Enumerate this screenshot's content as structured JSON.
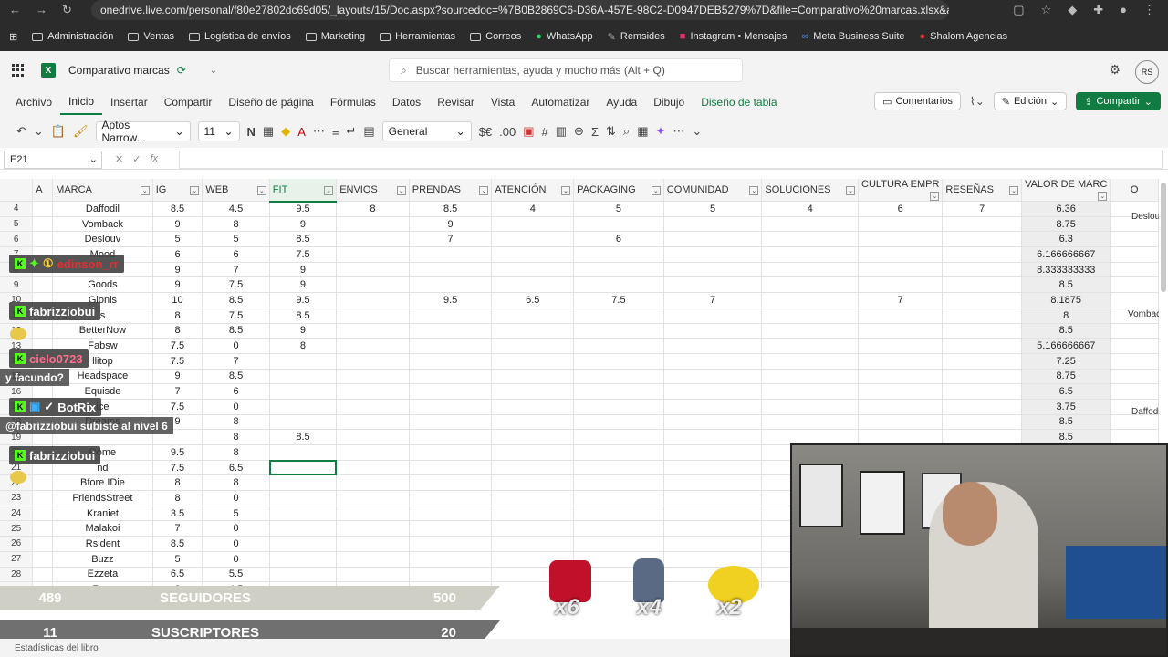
{
  "browser": {
    "url": "onedrive.live.com/personal/f80e27802dc69d05/_layouts/15/Doc.aspx?sourcedoc=%7B0B2869C6-D36A-457E-98C2-D0947DEB5279%7D&file=Comparativo%20marcas.xlsx&act...",
    "bookmarks": [
      "Administración",
      "Ventas",
      "Logística de envíos",
      "Marketing",
      "Herramientas",
      "Correos",
      "WhatsApp",
      "Remsides",
      "Instagram • Mensajes",
      "Meta Business Suite",
      "Shalom Agencias"
    ]
  },
  "app": {
    "doc_title": "Comparativo marcas",
    "search_placeholder": "Buscar herramientas, ayuda y mucho más (Alt + Q)",
    "avatar_initials": "RS",
    "menu": [
      "Archivo",
      "Inicio",
      "Insertar",
      "Compartir",
      "Diseño de página",
      "Fórmulas",
      "Datos",
      "Revisar",
      "Vista",
      "Automatizar",
      "Ayuda",
      "Dibujo",
      "Diseño de tabla"
    ],
    "comments_label": "Comentarios",
    "edit_label": "Edición",
    "share_label": "Compartir",
    "font_name": "Aptos Narrow...",
    "font_size": "11",
    "number_format": "General",
    "name_box": "E21",
    "fx_label": "fx"
  },
  "sheet": {
    "col_letters": [
      "A",
      "O"
    ],
    "headers": [
      "MARCA",
      "IG",
      "WEB",
      "FIT",
      "ENVIOS",
      "PRENDAS",
      "ATENCIÓN",
      "PACKAGING",
      "COMUNIDAD",
      "SOLUCIONES",
      "CULTURA EMPR",
      "RESEÑAS",
      "VALOR DE MARC"
    ],
    "rows": [
      {
        "n": "4",
        "c": [
          "Daffodil",
          "8.5",
          "4.5",
          "9.5",
          "8",
          "8.5",
          "4",
          "5",
          "5",
          "4",
          "6",
          "7",
          "6.36"
        ]
      },
      {
        "n": "5",
        "c": [
          "Vomback",
          "9",
          "8",
          "9",
          "",
          "9",
          "",
          "",
          "",
          "",
          "",
          "",
          "8.75"
        ]
      },
      {
        "n": "6",
        "c": [
          "Deslouv",
          "5",
          "5",
          "8.5",
          "",
          "7",
          "",
          "6",
          "",
          "",
          "",
          "",
          "6.3"
        ]
      },
      {
        "n": "7",
        "c": [
          "Mood",
          "6",
          "6",
          "7.5",
          "",
          "",
          "",
          "",
          "",
          "",
          "",
          "",
          "6.166666667"
        ]
      },
      {
        "n": "8",
        "c": [
          "",
          "9",
          "7",
          "9",
          "",
          "",
          "",
          "",
          "",
          "",
          "",
          "",
          "8.333333333"
        ]
      },
      {
        "n": "9",
        "c": [
          "Goods",
          "9",
          "7.5",
          "9",
          "",
          "",
          "",
          "",
          "",
          "",
          "",
          "",
          "8.5"
        ]
      },
      {
        "n": "10",
        "c": [
          "Glonis",
          "10",
          "8.5",
          "9.5",
          "",
          "9.5",
          "6.5",
          "7.5",
          "7",
          "",
          "7",
          "",
          "8.1875"
        ]
      },
      {
        "n": "11",
        "c": [
          "s",
          "8",
          "7.5",
          "8.5",
          "",
          "",
          "",
          "",
          "",
          "",
          "",
          "",
          "8"
        ]
      },
      {
        "n": "12",
        "c": [
          "BetterNow",
          "8",
          "8.5",
          "9",
          "",
          "",
          "",
          "",
          "",
          "",
          "",
          "",
          "8.5"
        ]
      },
      {
        "n": "13",
        "c": [
          "Fabsw",
          "7.5",
          "0",
          "8",
          "",
          "",
          "",
          "",
          "",
          "",
          "",
          "",
          "5.166666667"
        ]
      },
      {
        "n": "14",
        "c": [
          "llitop",
          "7.5",
          "7",
          "",
          "",
          "",
          "",
          "",
          "",
          "",
          "",
          "",
          "7.25"
        ]
      },
      {
        "n": "15",
        "c": [
          "Headspace",
          "9",
          "8.5",
          "",
          "",
          "",
          "",
          "",
          "",
          "",
          "",
          "",
          "8.75"
        ]
      },
      {
        "n": "16",
        "c": [
          "Equisde",
          "7",
          "6",
          "",
          "",
          "",
          "",
          "",
          "",
          "",
          "",
          "",
          "6.5"
        ]
      },
      {
        "n": "17",
        "c": [
          "ice",
          "7.5",
          "0",
          "",
          "",
          "",
          "",
          "",
          "",
          "",
          "",
          "",
          "3.75"
        ]
      },
      {
        "n": "18",
        "c": [
          "Dreams",
          "9",
          "8",
          "",
          "",
          "",
          "",
          "",
          "",
          "",
          "",
          "",
          "8.5"
        ]
      },
      {
        "n": "19",
        "c": [
          "",
          "",
          "8",
          "8.5",
          "",
          "",
          "",
          "",
          "",
          "",
          "",
          "",
          "8.5"
        ]
      },
      {
        "n": "20",
        "c": [
          "Rome",
          "9.5",
          "8",
          "",
          "",
          "",
          "",
          "",
          "",
          "",
          "",
          "",
          "8.75"
        ]
      },
      {
        "n": "21",
        "c": [
          "nd",
          "7.5",
          "6.5",
          "",
          "",
          "",
          "",
          "",
          "",
          "",
          "",
          "",
          ""
        ]
      },
      {
        "n": "22",
        "c": [
          "Bfore IDie",
          "8",
          "8",
          "",
          "",
          "",
          "",
          "",
          "",
          "",
          "",
          "",
          ""
        ]
      },
      {
        "n": "23",
        "c": [
          "FriendsStreet",
          "8",
          "0",
          "",
          "",
          "",
          "",
          "",
          "",
          "",
          "",
          "",
          ""
        ]
      },
      {
        "n": "24",
        "c": [
          "Kraniet",
          "3.5",
          "5",
          "",
          "",
          "",
          "",
          "",
          "",
          "",
          "",
          "",
          ""
        ]
      },
      {
        "n": "25",
        "c": [
          "Malakoi",
          "7",
          "0",
          "",
          "",
          "",
          "",
          "",
          "",
          "",
          "",
          "",
          ""
        ]
      },
      {
        "n": "26",
        "c": [
          "Rsident",
          "8.5",
          "0",
          "",
          "",
          "",
          "",
          "",
          "",
          "",
          "",
          "",
          ""
        ]
      },
      {
        "n": "27",
        "c": [
          "Buzz",
          "5",
          "0",
          "",
          "",
          "",
          "",
          "",
          "",
          "",
          "",
          "",
          ""
        ]
      },
      {
        "n": "28",
        "c": [
          "Ezzeta",
          "6.5",
          "5.5",
          "",
          "",
          "",
          "",
          "",
          "",
          "",
          "",
          "",
          ""
        ]
      },
      {
        "n": "29",
        "c": [
          "Free",
          "8",
          "4.5",
          "",
          "",
          "",
          "",
          "",
          "",
          "",
          "",
          "",
          ""
        ]
      }
    ],
    "side_labels": [
      "Deslouv",
      "Vombaci",
      "Daffodi"
    ],
    "status": "Estadísticas del libro"
  },
  "overlay": {
    "chat": [
      {
        "user": "edinson_rr",
        "color": "#e03030"
      },
      {
        "user": "fabrizziobui",
        "color": "#ffffff"
      },
      {
        "user": "cielo0723",
        "color": "#ff6f8e",
        "msg": "y facundo?"
      },
      {
        "user": "BotRix",
        "color": "#ffffff",
        "msg": "@fabrizziobui subiste al nivel 6"
      },
      {
        "user": "fabrizziobui",
        "color": "#ffffff"
      }
    ],
    "followers": {
      "current": "489",
      "label": "SEGUIDORES",
      "goal": "500"
    },
    "subs": {
      "current": "11",
      "label": "SUSCRIPTORES",
      "goal": "20"
    },
    "multipliers": [
      "x6",
      "x4",
      "x2"
    ]
  }
}
